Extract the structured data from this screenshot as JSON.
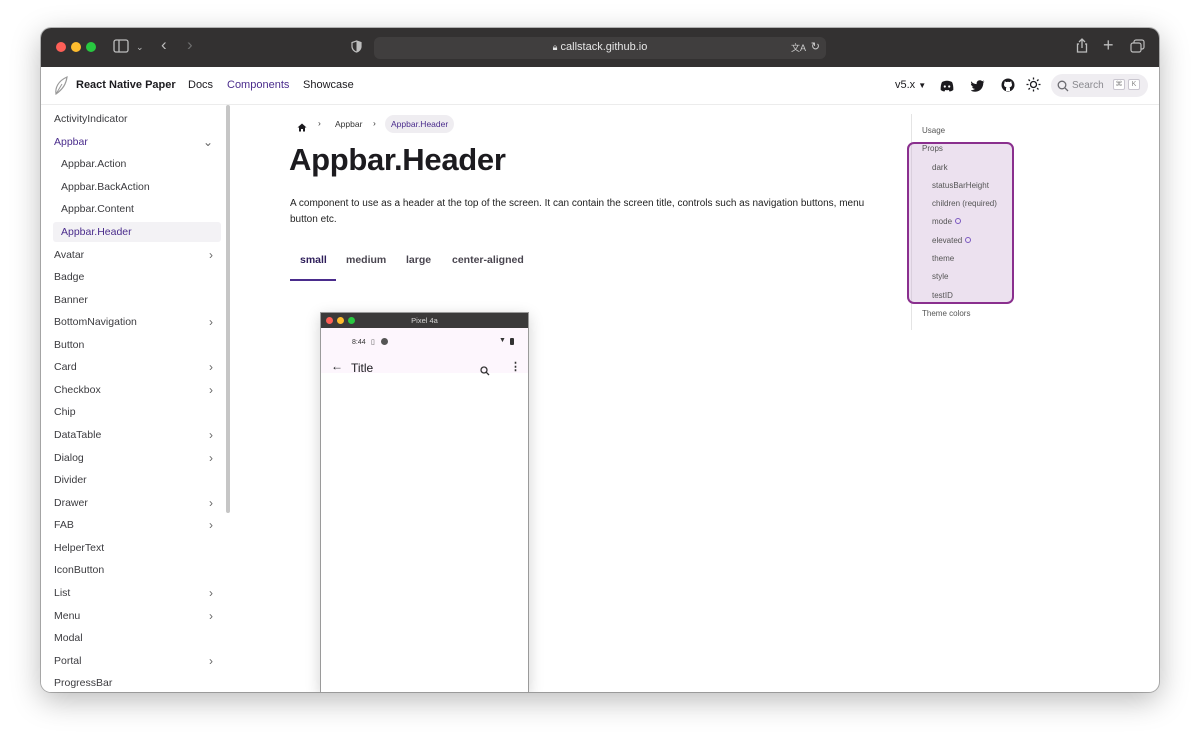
{
  "browser": {
    "url": "callstack.github.io"
  },
  "navbar": {
    "title": "React Native Paper",
    "links": [
      "Docs",
      "Components",
      "Showcase"
    ],
    "version": "v5.x",
    "search_placeholder": "Search",
    "search_keys": [
      "⌘",
      "K"
    ]
  },
  "sidebar": {
    "items": [
      {
        "label": "ActivityIndicator",
        "chevron": false
      },
      {
        "label": "Appbar",
        "chevron": "down"
      },
      {
        "label": "Appbar.Action",
        "chevron": false
      },
      {
        "label": "Appbar.BackAction",
        "chevron": false
      },
      {
        "label": "Appbar.Content",
        "chevron": false
      },
      {
        "label": "Appbar.Header",
        "chevron": false
      },
      {
        "label": "Avatar",
        "chevron": "right"
      },
      {
        "label": "Badge",
        "chevron": false
      },
      {
        "label": "Banner",
        "chevron": false
      },
      {
        "label": "BottomNavigation",
        "chevron": "right"
      },
      {
        "label": "Button",
        "chevron": false
      },
      {
        "label": "Card",
        "chevron": "right"
      },
      {
        "label": "Checkbox",
        "chevron": "right"
      },
      {
        "label": "Chip",
        "chevron": false
      },
      {
        "label": "DataTable",
        "chevron": "right"
      },
      {
        "label": "Dialog",
        "chevron": "right"
      },
      {
        "label": "Divider",
        "chevron": false
      },
      {
        "label": "Drawer",
        "chevron": "right"
      },
      {
        "label": "FAB",
        "chevron": "right"
      },
      {
        "label": "HelperText",
        "chevron": false
      },
      {
        "label": "IconButton",
        "chevron": false
      },
      {
        "label": "List",
        "chevron": "right"
      },
      {
        "label": "Menu",
        "chevron": "right"
      },
      {
        "label": "Modal",
        "chevron": false
      },
      {
        "label": "Portal",
        "chevron": "right"
      },
      {
        "label": "ProgressBar",
        "chevron": false
      }
    ]
  },
  "breadcrumb": {
    "items": [
      "Appbar",
      "Appbar.Header"
    ]
  },
  "main": {
    "title": "Appbar.Header",
    "description": "A component to use as a header at the top of the screen. It can contain the screen title, controls such as navigation buttons, menu button etc.",
    "tabs": [
      "small",
      "medium",
      "large",
      "center-aligned"
    ],
    "active_tab": "small"
  },
  "emulator": {
    "device": "Pixel 4a",
    "time": "8:44",
    "appbar_title": "Title"
  },
  "toc": {
    "items": [
      "Usage",
      "Props",
      "dark",
      "statusBarHeight",
      "children (required)",
      "mode",
      "elevated",
      "theme",
      "style",
      "testID",
      "Theme colors"
    ]
  },
  "colors": {
    "accent": "#4a2c8c",
    "highlight_border": "#8a2f8e",
    "toolbar": "#333131"
  }
}
